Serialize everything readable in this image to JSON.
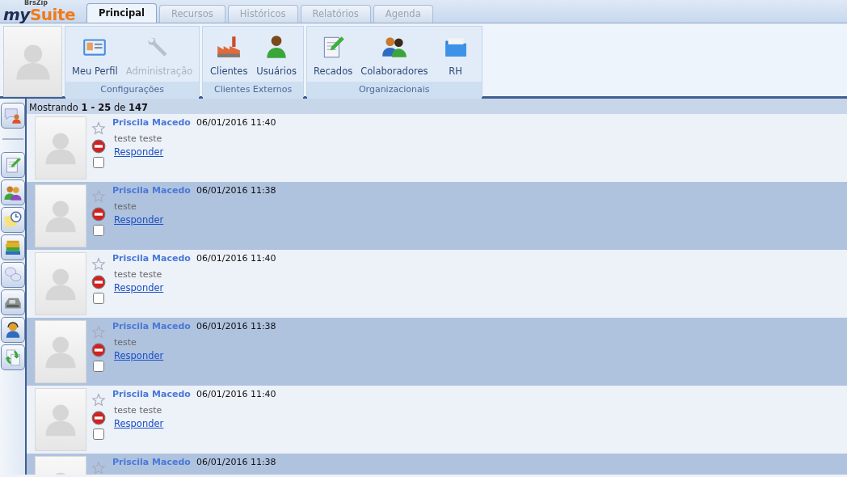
{
  "logo": {
    "tagline": "BrsZip",
    "name_a": "my",
    "name_b": "Suite"
  },
  "tabs": [
    {
      "label": "Principal",
      "selected": true
    },
    {
      "label": "Recursos",
      "selected": false
    },
    {
      "label": "Históricos",
      "selected": false
    },
    {
      "label": "Relatórios",
      "selected": false
    },
    {
      "label": "Agenda",
      "selected": false
    }
  ],
  "ribbon_groups": [
    {
      "title": "Configurações",
      "items": [
        {
          "label": "Meu Perfil",
          "kind": "card",
          "disabled": false
        },
        {
          "label": "Administração",
          "kind": "wrench",
          "disabled": true
        }
      ]
    },
    {
      "title": "Clientes Externos",
      "items": [
        {
          "label": "Clientes",
          "kind": "factory",
          "disabled": false
        },
        {
          "label": "Usuários",
          "kind": "user",
          "disabled": false
        }
      ]
    },
    {
      "title": "Organizacionais",
      "items": [
        {
          "label": "Recados",
          "kind": "notepad",
          "disabled": false
        },
        {
          "label": "Colaboradores",
          "kind": "users",
          "disabled": false
        },
        {
          "label": "RH",
          "kind": "folder",
          "disabled": false
        }
      ]
    }
  ],
  "sidebar": {
    "items": [
      {
        "kind": "chat-user"
      },
      {
        "kind": "notepad"
      },
      {
        "kind": "group"
      },
      {
        "kind": "clock"
      },
      {
        "kind": "books"
      },
      {
        "kind": "bubbles"
      },
      {
        "kind": "phone"
      },
      {
        "kind": "headset"
      },
      {
        "kind": "sync"
      }
    ]
  },
  "summary": "Mostrando **1 - 25** de **147**",
  "messages": [
    {
      "author": "Priscila Macedo",
      "date": "06/01/2016 11:40",
      "text": "teste teste",
      "link": "Responder",
      "checked": false
    },
    {
      "author": "Priscila Macedo",
      "date": "06/01/2016 11:38",
      "text": "teste",
      "link": "Responder",
      "checked": false
    },
    {
      "author": "Priscila Macedo",
      "date": "06/01/2016 11:40",
      "text": "teste teste",
      "link": "Responder",
      "checked": false
    },
    {
      "author": "Priscila Macedo",
      "date": "06/01/2016 11:38",
      "text": "teste",
      "link": "Responder",
      "checked": false
    },
    {
      "author": "Priscila Macedo",
      "date": "06/01/2016 11:40",
      "text": "teste teste",
      "link": "Responder",
      "checked": false
    },
    {
      "author": "Priscila Macedo",
      "date": "06/01/2016 11:38"
    }
  ]
}
